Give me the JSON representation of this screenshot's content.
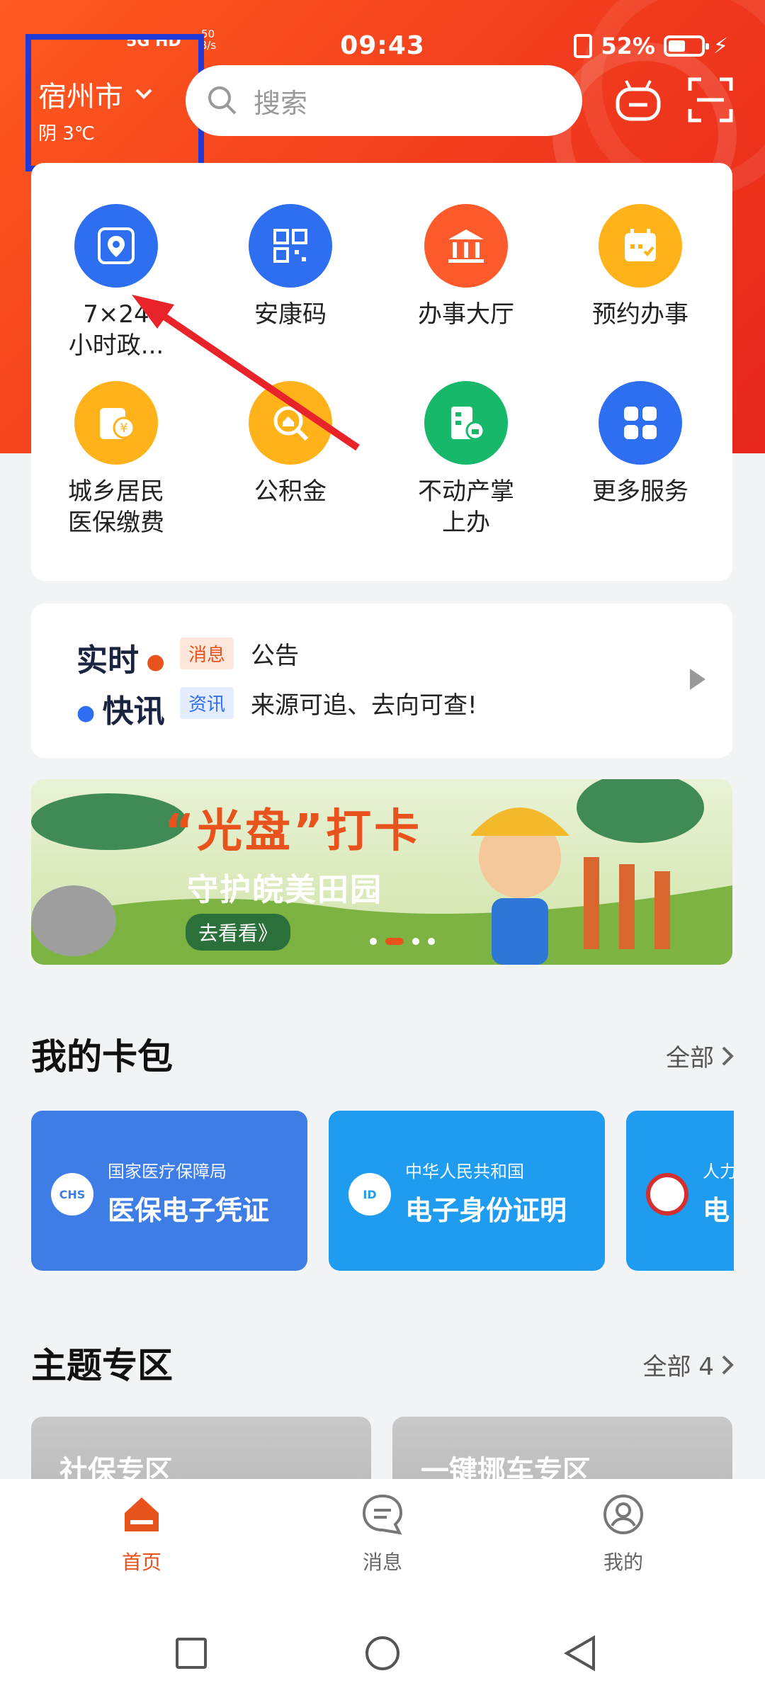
{
  "status": {
    "time": "09:43",
    "signal": "5G HD",
    "net_speed": "50\nB/s",
    "battery": "52%",
    "battery_level": 0.52
  },
  "header": {
    "city": "宿州市",
    "weather": "阴 3℃",
    "search_placeholder": "搜索"
  },
  "services": [
    {
      "label": "7×24\n小时政...",
      "icon": "map-pin-icon",
      "color": "#2d6ff0"
    },
    {
      "label": "安康码",
      "icon": "qr-code-icon",
      "color": "#2d6ff0"
    },
    {
      "label": "办事大厅",
      "icon": "building-icon",
      "color": "#ff5a2c"
    },
    {
      "label": "预约办事",
      "icon": "calendar-icon",
      "color": "#ffb21a"
    },
    {
      "label": "城乡居民\n医保缴费",
      "icon": "yuan-card-icon",
      "color": "#ffb21a"
    },
    {
      "label": "公积金",
      "icon": "fund-search-icon",
      "color": "#ffb21a"
    },
    {
      "label": "不动产掌\n上办",
      "icon": "property-icon",
      "color": "#17b86a"
    },
    {
      "label": "更多服务",
      "icon": "grid-icon",
      "color": "#2d6ff0"
    }
  ],
  "news": {
    "brand_line1": "实时",
    "brand_line2": "快讯",
    "items": [
      {
        "tag": "消息",
        "text": "公告",
        "tag_color": "#e8521d",
        "tag_bg": "#fde7dd"
      },
      {
        "tag": "资讯",
        "text": "来源可追、去向可查!",
        "tag_color": "#2d6ff0",
        "tag_bg": "#e3edff"
      }
    ]
  },
  "banner": {
    "title": "“光盘”打卡",
    "subtitle": "守护皖美田园",
    "button": "去看看》"
  },
  "wallet": {
    "title": "我的卡包",
    "more": "全部",
    "cards": [
      {
        "org": "国家医疗保障局",
        "name": "医保电子凭证",
        "logo": "CHS",
        "color": "#3f7de6"
      },
      {
        "org": "中华人民共和国",
        "name": "电子身份证明",
        "logo": "ID",
        "color": "#1f9cf0"
      },
      {
        "org": "人力",
        "name": "电",
        "logo": "",
        "color": "#1f9cf0"
      }
    ]
  },
  "themes": {
    "title": "主题专区",
    "more": "全部 4",
    "items": [
      {
        "name": "社保专区"
      },
      {
        "name": "一键挪车专区"
      }
    ]
  },
  "nav": [
    {
      "label": "首页",
      "active": true
    },
    {
      "label": "消息",
      "active": false
    },
    {
      "label": "我的",
      "active": false
    }
  ],
  "accent": "#e8521d"
}
